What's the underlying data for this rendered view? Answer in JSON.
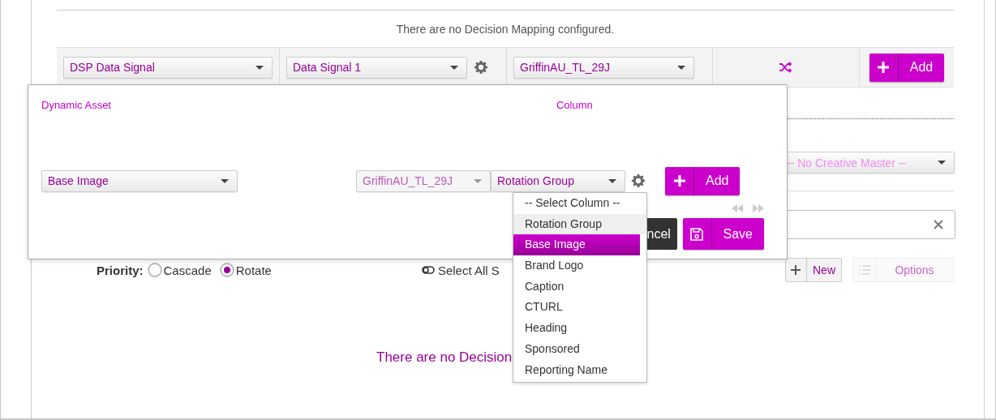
{
  "header_message": "There are no Decision Mapping configured.",
  "mapping_row": {
    "source_select": "DSP Data Signal",
    "signal_select": "Data Signal 1",
    "feed_select": "GriffinAU_TL_29J",
    "add_button": "Add"
  },
  "creative_master_select": "-- No Creative Master --",
  "priority": {
    "label": "Priority:",
    "options": [
      {
        "label": "Cascade",
        "selected": false
      },
      {
        "label": "Rotate",
        "selected": true
      }
    ]
  },
  "select_all": "Select All S",
  "new_button": "New",
  "options_button": {
    "label": "Options",
    "disabled": true
  },
  "empty_message": "There are no Decision",
  "popup": {
    "asset_label": "Dynamic Asset",
    "column_label": "Column",
    "asset_select": "Base Image",
    "feed_select": {
      "value": "GriffinAU_TL_29J",
      "disabled": true
    },
    "column_select": "Rotation Group",
    "add_button": "Add",
    "cancel_button": "ncel",
    "save_button": "Save"
  },
  "column_dropdown": {
    "items": [
      {
        "label": "-- Select Column --",
        "selected": false,
        "current": false
      },
      {
        "label": "Rotation Group",
        "selected": false,
        "current": true
      },
      {
        "label": "Base Image",
        "selected": true,
        "current": false
      },
      {
        "label": "Brand Logo",
        "selected": false,
        "current": false
      },
      {
        "label": "Caption",
        "selected": false,
        "current": false
      },
      {
        "label": "CTURL",
        "selected": false,
        "current": false
      },
      {
        "label": "Heading",
        "selected": false,
        "current": false
      },
      {
        "label": "Sponsored",
        "selected": false,
        "current": false
      },
      {
        "label": "Reporting Name",
        "selected": false,
        "current": false
      }
    ]
  }
}
